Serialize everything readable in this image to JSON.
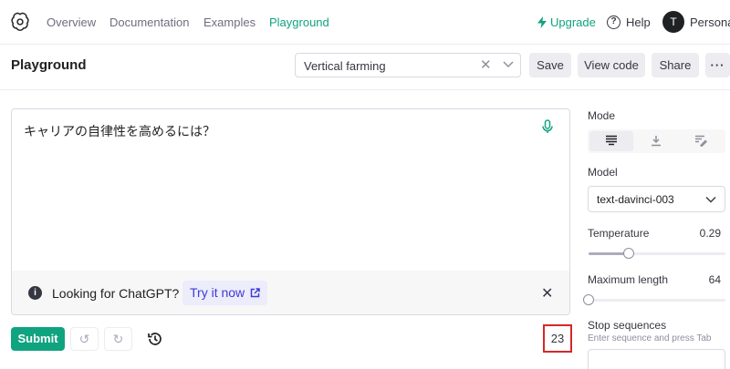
{
  "nav": {
    "logo_icon": "openai-logo-icon",
    "links": [
      "Overview",
      "Documentation",
      "Examples",
      "Playground"
    ],
    "active": "Playground",
    "upgrade": "Upgrade",
    "help": "Help",
    "avatar_initial": "T",
    "account": "Persona"
  },
  "header": {
    "title": "Playground",
    "preset": "Vertical farming",
    "save": "Save",
    "view_code": "View code",
    "share": "Share",
    "more": "···"
  },
  "editor": {
    "text": "キャリアの自律性を高めるには？",
    "banner_text": "Looking for ChatGPT?",
    "banner_link": "Try it now",
    "info_glyph": "i"
  },
  "controls": {
    "submit": "Submit",
    "undo_icon": "undo-icon",
    "redo_icon": "redo-icon",
    "history_icon": "history-icon",
    "token_count": "23"
  },
  "panel": {
    "mode_label": "Mode",
    "modes": [
      "complete",
      "insert",
      "edit"
    ],
    "active_mode": "complete",
    "model_label": "Model",
    "model": "text-davinci-003",
    "temperature_label": "Temperature",
    "temperature": "0.29",
    "temperature_fraction": 0.29,
    "max_length_label": "Maximum length",
    "max_length": "64",
    "max_length_fraction": 0.0,
    "stop_label": "Stop sequences",
    "stop_placeholder": "Enter sequence and press Tab"
  },
  "colors": {
    "accent": "#10a37f",
    "link": "#3e3ad8",
    "highlight_border": "#d62828"
  }
}
